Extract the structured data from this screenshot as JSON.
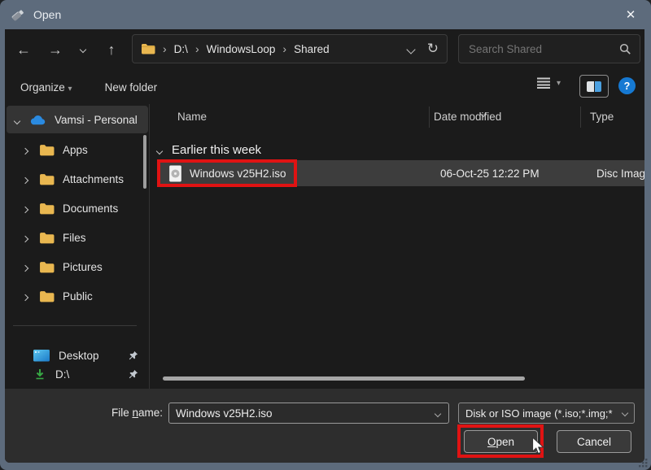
{
  "titlebar": {
    "title": "Open"
  },
  "icons": {
    "back": "←",
    "forward": "→",
    "up": "↑",
    "refresh": "↻",
    "close": "✕",
    "help": "?",
    "organize_caret": "▾",
    "views_caret": "▾",
    "crumb_sep": "›"
  },
  "nav": {
    "crumbs": [
      "D:\\",
      "WindowsLoop",
      "Shared"
    ],
    "search_placeholder": "Search Shared"
  },
  "toolbar": {
    "organize": "Organize",
    "new_folder": "New folder"
  },
  "sidebar": {
    "root_label": "Vamsi - Personal",
    "folders": [
      "Apps",
      "Attachments",
      "Documents",
      "Files",
      "Pictures",
      "Public"
    ],
    "desktop_label": "Desktop",
    "drive_label": "D:\\"
  },
  "main": {
    "col_name": "Name",
    "col_date": "Date modified",
    "col_type": "Type",
    "group_label": "Earlier this week",
    "file": {
      "name": "Windows v25H2.iso",
      "date": "06-Oct-25 12:22 PM",
      "type": "Disc Image F"
    }
  },
  "footer": {
    "file_name_pre": "File ",
    "file_name_mn": "n",
    "file_name_post": "ame:",
    "file_name_value": "Windows v25H2.iso",
    "file_type_value": "Disk or ISO image (*.iso;*.img;*",
    "open_mn": "O",
    "open_post": "pen",
    "cancel": "Cancel"
  }
}
